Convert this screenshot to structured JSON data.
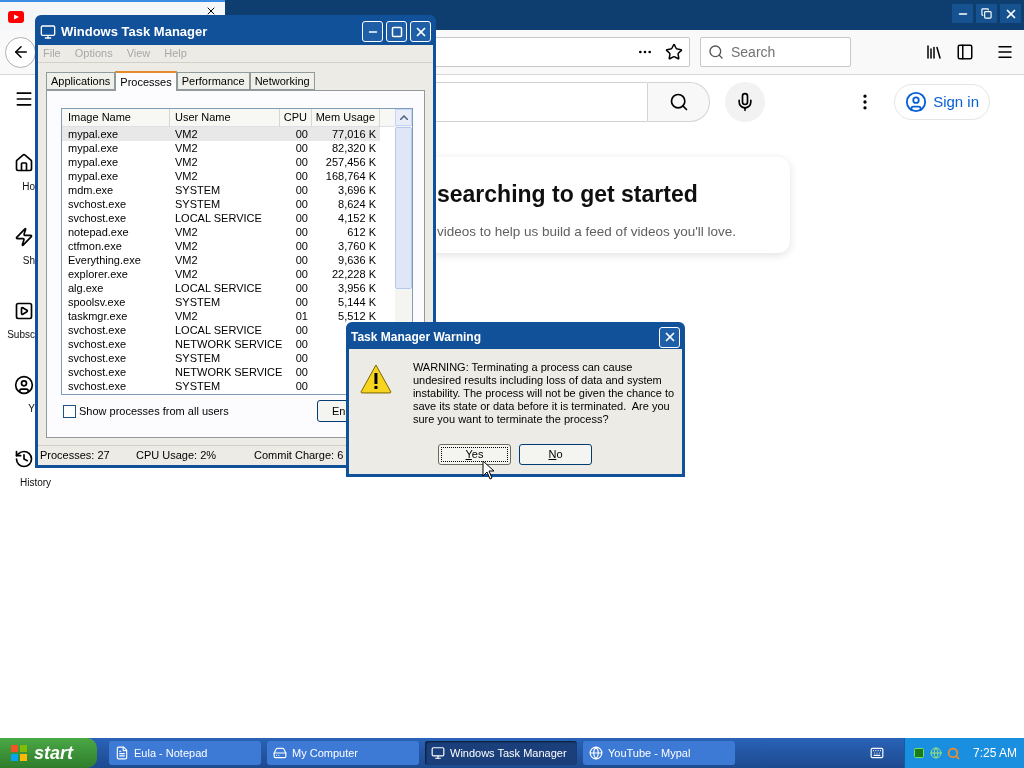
{
  "browser": {
    "search_placeholder": "Search",
    "page": {
      "sidebar": [
        {
          "label": "Ho"
        },
        {
          "label": "Sh"
        },
        {
          "label": "Subsc"
        },
        {
          "label": "Y"
        },
        {
          "label": "History"
        }
      ],
      "sign_in": "Sign in",
      "card": {
        "title": "searching to get started",
        "subtitle": "videos to help us build a feed of videos you'll love."
      }
    }
  },
  "task_manager": {
    "title": "Windows Task Manager",
    "menu": [
      {
        "label": "File",
        "disabled": true
      },
      {
        "label": "Options",
        "disabled": true
      },
      {
        "label": "View",
        "disabled": true
      },
      {
        "label": "Help",
        "disabled": true
      }
    ],
    "tabs": [
      {
        "label": "Applications",
        "selected": false
      },
      {
        "label": "Processes",
        "selected": true
      },
      {
        "label": "Performance",
        "selected": false
      },
      {
        "label": "Networking",
        "selected": false
      }
    ],
    "columns": [
      "Image Name",
      "User Name",
      "CPU",
      "Mem Usage"
    ],
    "rows": [
      {
        "image": "mypal.exe",
        "user": "VM2",
        "cpu": "00",
        "mem": "77,016 K",
        "selected": true
      },
      {
        "image": "mypal.exe",
        "user": "VM2",
        "cpu": "00",
        "mem": "82,320 K",
        "selected": false
      },
      {
        "image": "mypal.exe",
        "user": "VM2",
        "cpu": "00",
        "mem": "257,456 K",
        "selected": false
      },
      {
        "image": "mypal.exe",
        "user": "VM2",
        "cpu": "00",
        "mem": "168,764 K",
        "selected": false
      },
      {
        "image": "mdm.exe",
        "user": "SYSTEM",
        "cpu": "00",
        "mem": "3,696 K",
        "selected": false
      },
      {
        "image": "svchost.exe",
        "user": "SYSTEM",
        "cpu": "00",
        "mem": "8,624 K",
        "selected": false
      },
      {
        "image": "svchost.exe",
        "user": "LOCAL SERVICE",
        "cpu": "00",
        "mem": "4,152 K",
        "selected": false
      },
      {
        "image": "notepad.exe",
        "user": "VM2",
        "cpu": "00",
        "mem": "612 K",
        "selected": false
      },
      {
        "image": "ctfmon.exe",
        "user": "VM2",
        "cpu": "00",
        "mem": "3,760 K",
        "selected": false
      },
      {
        "image": "Everything.exe",
        "user": "VM2",
        "cpu": "00",
        "mem": "9,636 K",
        "selected": false
      },
      {
        "image": "explorer.exe",
        "user": "VM2",
        "cpu": "00",
        "mem": "22,228 K",
        "selected": false
      },
      {
        "image": "alg.exe",
        "user": "LOCAL SERVICE",
        "cpu": "00",
        "mem": "3,956 K",
        "selected": false
      },
      {
        "image": "spoolsv.exe",
        "user": "SYSTEM",
        "cpu": "00",
        "mem": "5,144 K",
        "selected": false
      },
      {
        "image": "taskmgr.exe",
        "user": "VM2",
        "cpu": "01",
        "mem": "5,512 K",
        "selected": false
      },
      {
        "image": "svchost.exe",
        "user": "LOCAL SERVICE",
        "cpu": "00",
        "selected": false
      },
      {
        "image": "svchost.exe",
        "user": "NETWORK SERVICE",
        "cpu": "00",
        "selected": false
      },
      {
        "image": "svchost.exe",
        "user": "SYSTEM",
        "cpu": "00",
        "selected": false
      },
      {
        "image": "svchost.exe",
        "user": "NETWORK SERVICE",
        "cpu": "00",
        "selected": false
      },
      {
        "image": "svchost.exe",
        "user": "SYSTEM",
        "cpu": "00",
        "selected": false
      }
    ],
    "show_all": {
      "label": "Show processes from all users",
      "checked": false
    },
    "end_button": "En",
    "status": [
      "Processes: 27",
      "CPU Usage: 2%",
      "Commit Charge: 6"
    ]
  },
  "dialog": {
    "title": "Task Manager Warning",
    "message": "WARNING: Terminating a process can cause undesired results including loss of data and system instability. The process will not be given the chance to save its state or data before it is terminated.  Are you sure you want to terminate the process?",
    "buttons": [
      {
        "label": "Yes",
        "focused": true
      },
      {
        "label": "No",
        "focused": false
      }
    ]
  },
  "taskbar": {
    "start": "start",
    "tasks": [
      {
        "label": "Eula - Notepad",
        "selected": false
      },
      {
        "label": "My Computer",
        "selected": false
      },
      {
        "label": "Windows Task Manager",
        "selected": true
      },
      {
        "label": "YouTube - Mypal",
        "selected": false
      }
    ],
    "clock": "7:25 AM"
  }
}
